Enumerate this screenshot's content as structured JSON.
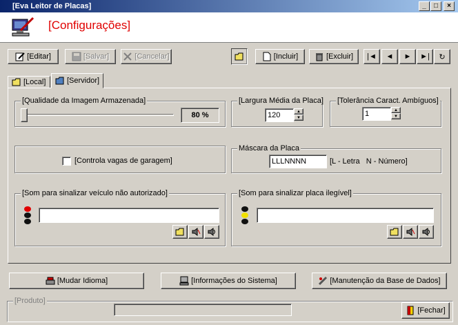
{
  "window": {
    "title": "[Eva Leitor de Placas]",
    "min": "_",
    "max": "□",
    "close": "×"
  },
  "header": {
    "title": "[Configurações]"
  },
  "toolbar": {
    "edit": "[Editar]",
    "save": "[Salvar]",
    "cancel": "[Cancelar]",
    "add": "[Incluir]",
    "delete": "[Excluir]",
    "first": "|◄",
    "prev": "◄",
    "next": "►",
    "last": "►|",
    "refresh": "↻"
  },
  "tabs": [
    {
      "label": "[Local]"
    },
    {
      "label": "[Servidor]"
    }
  ],
  "quality": {
    "label": "[Qualidade da Imagem Armazenada]",
    "value": "80 %",
    "level": 0.0
  },
  "width": {
    "label": "[Largura Média da Placa]",
    "value": "120"
  },
  "tolerance": {
    "label": "[Tolerância Caract. Ambíguos]",
    "value": "1"
  },
  "garage": {
    "label": "[Controla vagas de garagem]"
  },
  "mask": {
    "label": "Máscara da Placa",
    "value": "LLLNNNN",
    "hint": "[L - Letra   N - Número]"
  },
  "sound_unauth": {
    "label": "[Som para sinalizar veículo não autorizado]",
    "value": ""
  },
  "sound_illegible": {
    "label": "[Som para sinalizar placa ilegível]",
    "value": ""
  },
  "bottom": {
    "language": "[Mudar Idioma]",
    "sysinfo": "[Informações do Sistema]",
    "maintenance": "[Manutenção da Base de Dados]",
    "product": "[Produto]",
    "close": "[Fechar]"
  }
}
